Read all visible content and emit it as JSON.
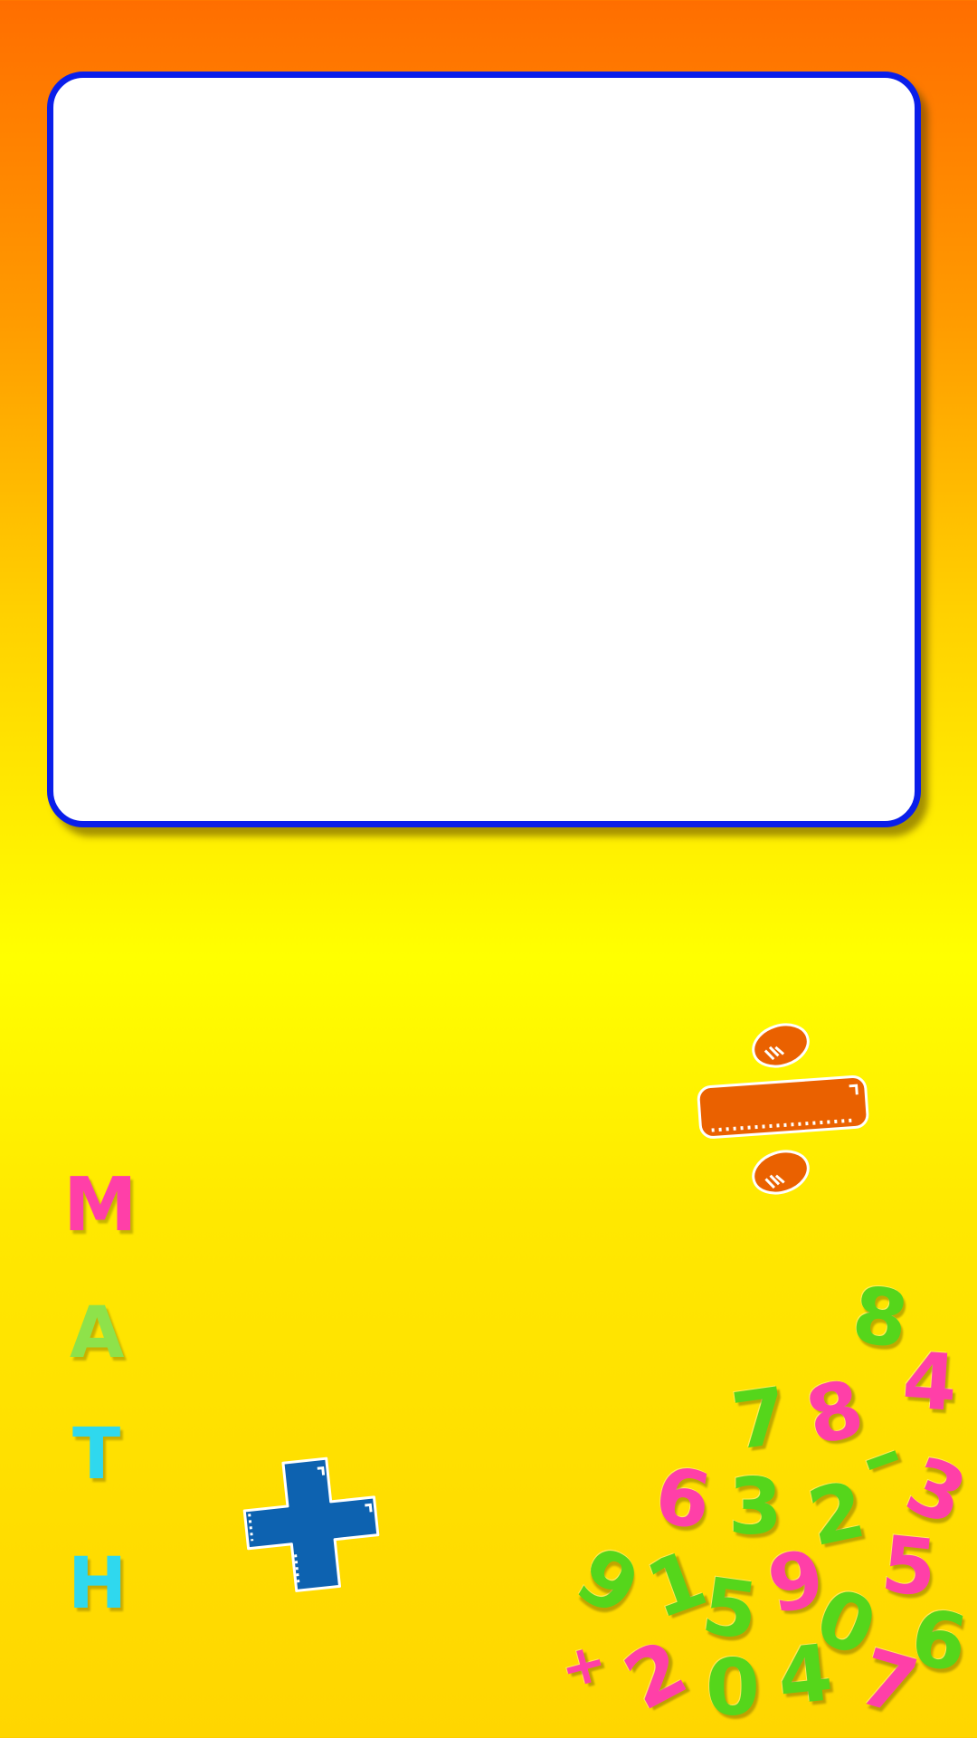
{
  "board": {
    "content": ""
  },
  "math_word": [
    "M",
    "A",
    "T",
    "H"
  ],
  "colors": {
    "board_border": "#0a1eea",
    "background_top": "#ff6e00",
    "background_bottom": "#ffd600",
    "divide_sign": "#ea6100",
    "plus_sign": "#0d62b0"
  },
  "icons": [
    "divide-sign-icon",
    "plus-sign-icon"
  ],
  "number_magnets": {
    "d1": "8",
    "d2": "4",
    "d3": "7",
    "d4": "8",
    "d5": "–",
    "d6": "6",
    "d7": "3",
    "d8": "2",
    "d9": "3",
    "d10": "9",
    "d11": "1",
    "d12": "5",
    "d13": "9",
    "d14": "5",
    "d15": "+",
    "d16": "2",
    "d17": "0",
    "d18": "4",
    "d19": "0",
    "d20": "7",
    "d21": "6"
  }
}
